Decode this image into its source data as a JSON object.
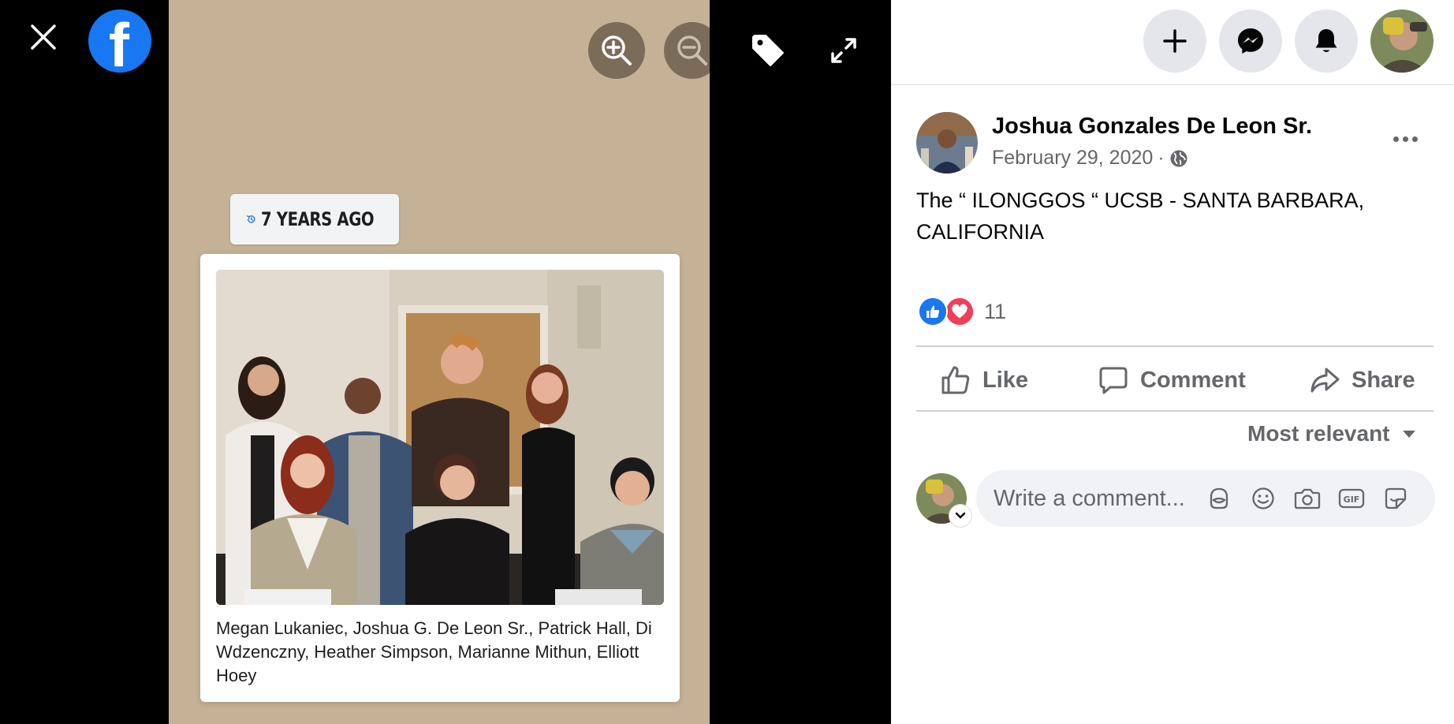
{
  "viewer": {
    "memory_label": "7 YEARS AGO",
    "caption": "Megan Lukaniec, Joshua G. De Leon Sr., Patrick Hall, Di Wdzenczny, Heather Simpson, Marianne Mithun, Elliott Hoey",
    "icons": {
      "close": "close-icon",
      "logo": "facebook-logo",
      "zoom_in": "zoom-in-icon",
      "zoom_out": "zoom-out-icon",
      "tag": "tag-icon",
      "fullscreen": "expand-icon"
    }
  },
  "topbar": {
    "icons": [
      "plus-icon",
      "messenger-icon",
      "bell-icon",
      "profile-avatar"
    ]
  },
  "post": {
    "author": "Joshua Gonzales De Leon Sr.",
    "date": "February 29, 2020",
    "separator": "·",
    "audience_icon": "globe-icon",
    "text": "The “ ILONGGOS “ UCSB - SANTA BARBARA, CALIFORNIA",
    "reaction_count": "11",
    "reaction_icons": [
      "like-reaction",
      "love-reaction"
    ]
  },
  "actions": {
    "like": "Like",
    "comment": "Comment",
    "share": "Share"
  },
  "comments": {
    "sort_label": "Most relevant",
    "placeholder": "Write a comment...",
    "input_icons": [
      "avatar-sticker-icon",
      "emoji-icon",
      "camera-icon",
      "gif-icon",
      "sticker-icon"
    ]
  },
  "colors": {
    "brand": "#1877f2",
    "love": "#f33e58",
    "photo_background": "#c4b196",
    "secondary_text": "#65676b"
  }
}
